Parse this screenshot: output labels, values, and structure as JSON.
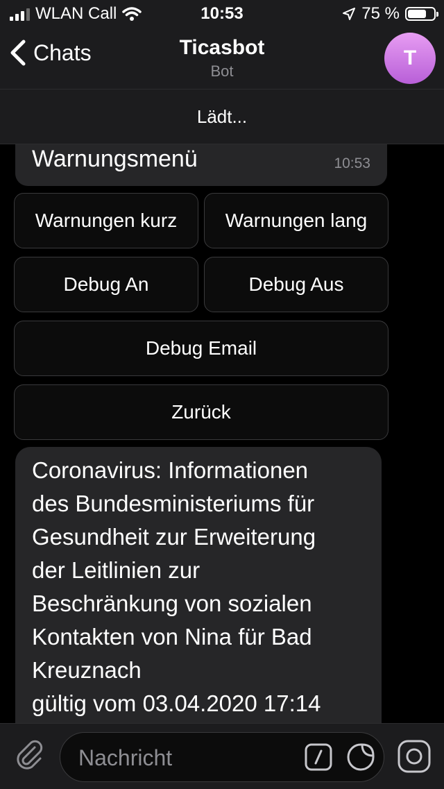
{
  "status_bar": {
    "carrier": "WLAN Call",
    "time": "10:53",
    "battery_percent": "75 %",
    "battery_level": 0.75
  },
  "nav": {
    "back_label": "Chats",
    "title": "Ticasbot",
    "subtitle": "Bot",
    "avatar_initial": "T"
  },
  "loading": {
    "text": "Lädt..."
  },
  "messages": {
    "menu_message": {
      "text": "Warnungsmenü",
      "time": "10:53"
    },
    "info_message": {
      "text": "Coronavirus: Informationen\ndes Bundesministeriums für\nGesundheit zur Erweiterung\nder Leitlinien zur\nBeschränkung von sozialen\nKontakten von Nina für Bad\nKreuznach\ngültig vom 03.04.2020 17:14"
    }
  },
  "keyboard": {
    "warnungen_kurz": "Warnungen kurz",
    "warnungen_lang": "Warnungen lang",
    "debug_an": "Debug An",
    "debug_aus": "Debug Aus",
    "debug_email": "Debug Email",
    "zurueck": "Zurück"
  },
  "input": {
    "placeholder": "Nachricht"
  },
  "colors": {
    "background": "#000000",
    "bar": "#1c1c1e",
    "bubble": "#262628",
    "avatar": "#c77be0",
    "secondary_text": "#8e8e93"
  }
}
